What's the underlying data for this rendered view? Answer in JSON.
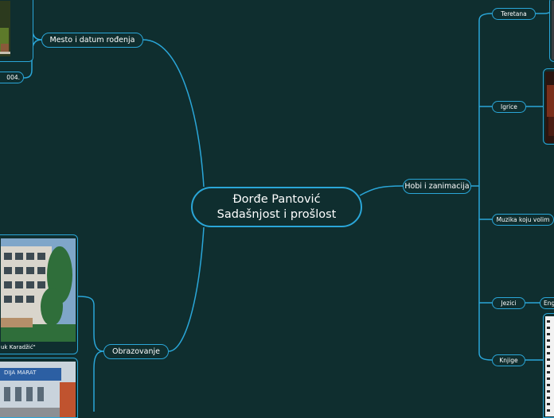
{
  "central": {
    "line1": "Đorđe Pantović",
    "line2": "Sadašnjost i prošlost"
  },
  "branches": {
    "birth": "Mesto i datum rođenja",
    "hobbies": "Hobi i zanimacija",
    "education": "Obrazovanje"
  },
  "hobby_items": {
    "gym": "Teretana",
    "games": "Igrice",
    "music": "Muzika koju volim",
    "languages": "Jezici",
    "books": "Knjige",
    "english": "Eng"
  },
  "captions": {
    "birth_date": "004.",
    "school": "uk Karadžić\""
  },
  "sign_text": "DIJA MARAT",
  "colors": {
    "background": "#0f2e2f",
    "line": "#2aa6d8",
    "text": "#ffffff"
  }
}
